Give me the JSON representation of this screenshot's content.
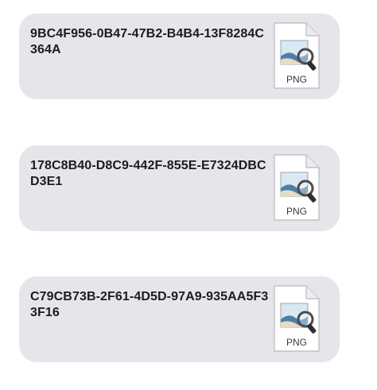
{
  "messages": [
    {
      "filename": "9BC4F956-0B47-47B2-B4B4-13F8284C364A",
      "file_type": "PNG",
      "icon": "png-file-icon"
    },
    {
      "filename": "178C8B40-D8C9-442F-855E-E7324DBCD3E1",
      "file_type": "PNG",
      "icon": "png-file-icon"
    },
    {
      "filename": "C79CB73B-2F61-4D5D-97A9-935AA5F33F16",
      "file_type": "PNG",
      "icon": "png-file-icon"
    }
  ],
  "colors": {
    "bubble": "#e5e5ea",
    "text": "#1c1c1e"
  }
}
